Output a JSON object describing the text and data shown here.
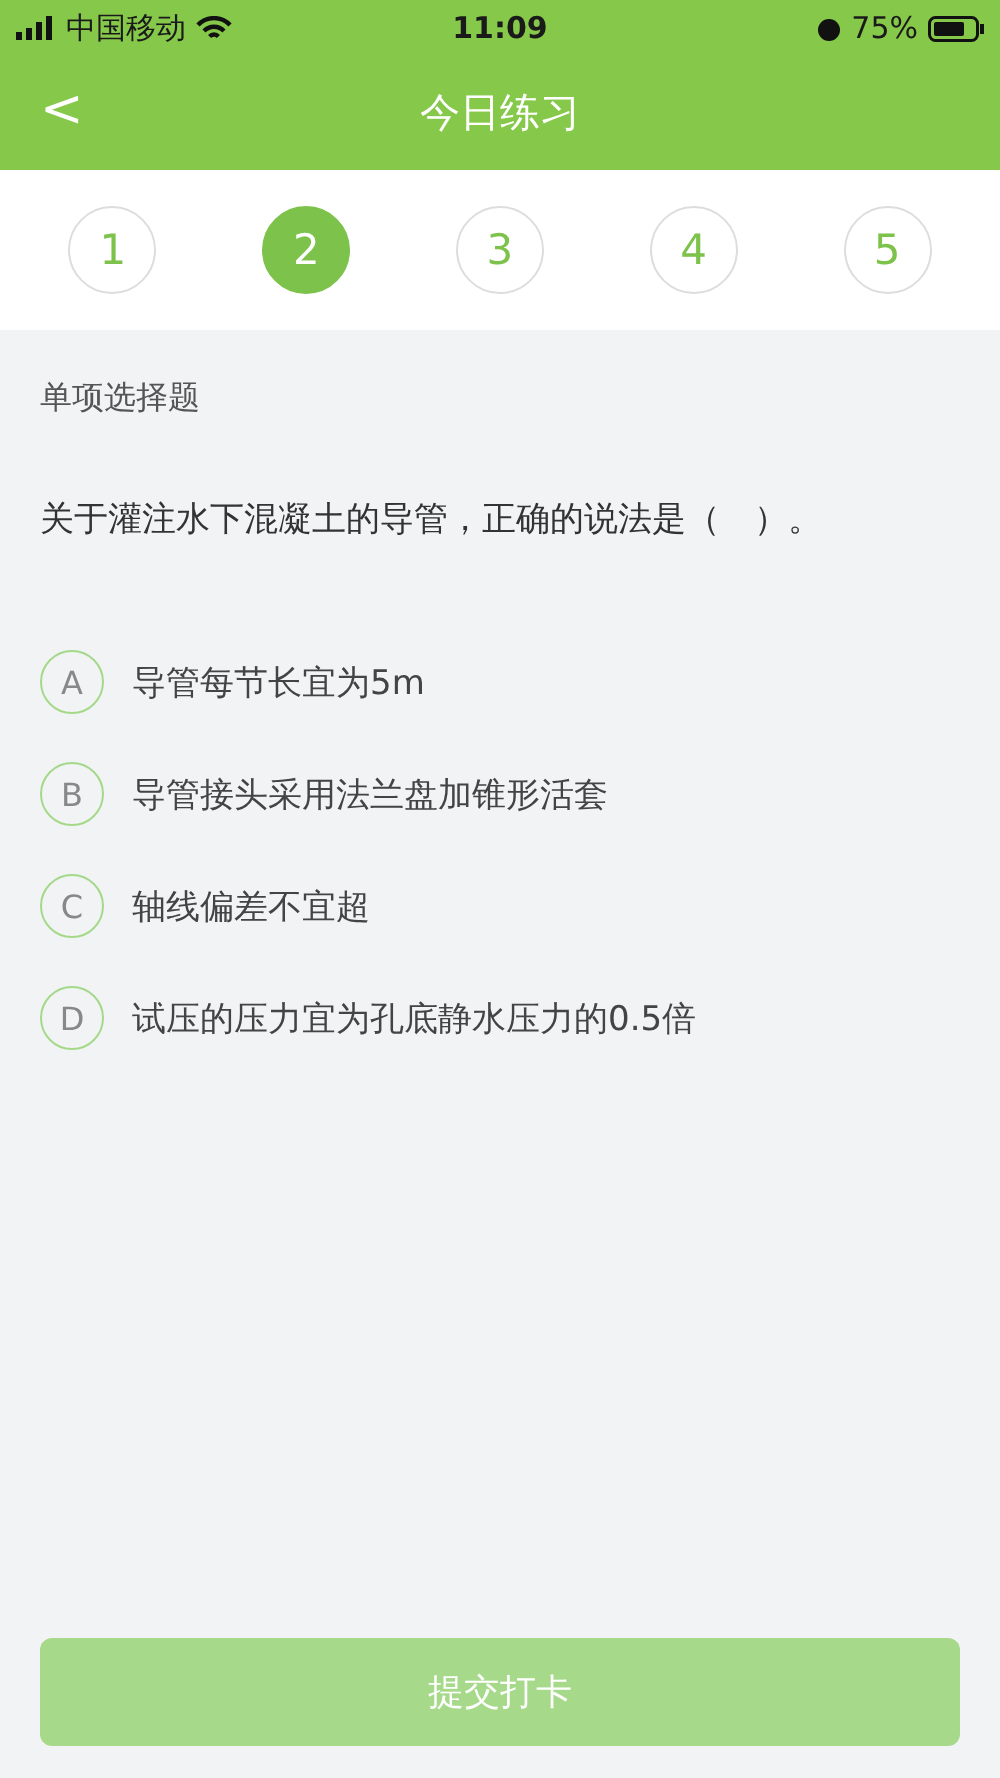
{
  "status_bar": {
    "carrier": "中国移动",
    "time": "11:09",
    "battery": "75%"
  },
  "header": {
    "back": "<",
    "title": "今日练习"
  },
  "steps": [
    {
      "label": "1",
      "selected": false
    },
    {
      "label": "2",
      "selected": true
    },
    {
      "label": "3",
      "selected": false
    },
    {
      "label": "4",
      "selected": false
    },
    {
      "label": "5",
      "selected": false
    }
  ],
  "question": {
    "type": "单项选择题",
    "text": "关于灌注水下混凝土的导管，正确的说法是（　）。"
  },
  "options": [
    {
      "letter": "A",
      "text": "导管每节长宜为5m"
    },
    {
      "letter": "B",
      "text": "导管接头采用法兰盘加锥形活套"
    },
    {
      "letter": "C",
      "text": "轴线偏差不宜超"
    },
    {
      "letter": "D",
      "text": "试压的压力宜为孔底静水压力的0.5倍"
    }
  ],
  "submit_button": "提交打卡"
}
